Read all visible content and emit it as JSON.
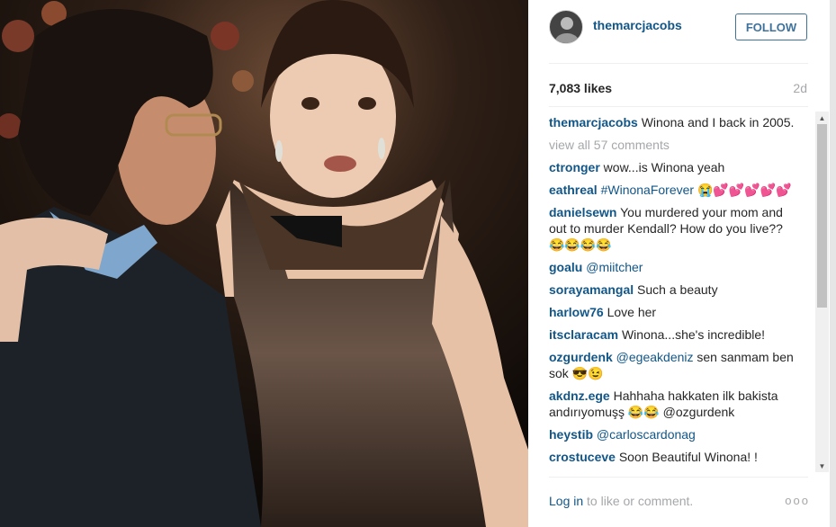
{
  "post": {
    "username": "themarcjacobs",
    "follow_label": "FOLLOW",
    "likes": "7,083 likes",
    "time_ago": "2d",
    "caption": {
      "user": "themarcjacobs",
      "text": " Winona and I back in 2005."
    },
    "view_all": "view all 57 comments",
    "comments": [
      {
        "user": "ctronger",
        "mention": "",
        "text": " wow...is Winona yeah"
      },
      {
        "user": "eathreal",
        "mention": " #WinonaForever",
        "text": " 😭💕💕💕💕💕"
      },
      {
        "user": "danielsewn",
        "mention": "",
        "text": " You murdered your mom and out to murder Kendall? How do you live??😂😂😂😂"
      },
      {
        "user": "goalu",
        "mention": " @miitcher",
        "text": ""
      },
      {
        "user": "sorayamangal",
        "mention": "",
        "text": " Such a beauty"
      },
      {
        "user": "harlow76",
        "mention": "",
        "text": " Love her"
      },
      {
        "user": "itsclaracam",
        "mention": "",
        "text": " Winona...she's incredible!"
      },
      {
        "user": "ozgurdenk",
        "mention": " @egeakdeniz",
        "text": " sen sanmam ben sok 😎😉"
      },
      {
        "user": "akdnz.ege",
        "mention": "",
        "text": " Hahhaha hakkaten ilk bakista andırıyomuşş 😂😂 @ozgurdenk"
      },
      {
        "user": "heystib",
        "mention": " @carloscardonag",
        "text": ""
      },
      {
        "user": "crostuceve",
        "mention": "",
        "text": " Soon Beautiful Winona! !"
      }
    ],
    "footer_login": "Log in",
    "footer_text": " to like or comment.",
    "more_label": "ooo"
  },
  "colors": {
    "link": "#125688",
    "follow": "#3f729b",
    "muted": "#a5a7aa"
  }
}
